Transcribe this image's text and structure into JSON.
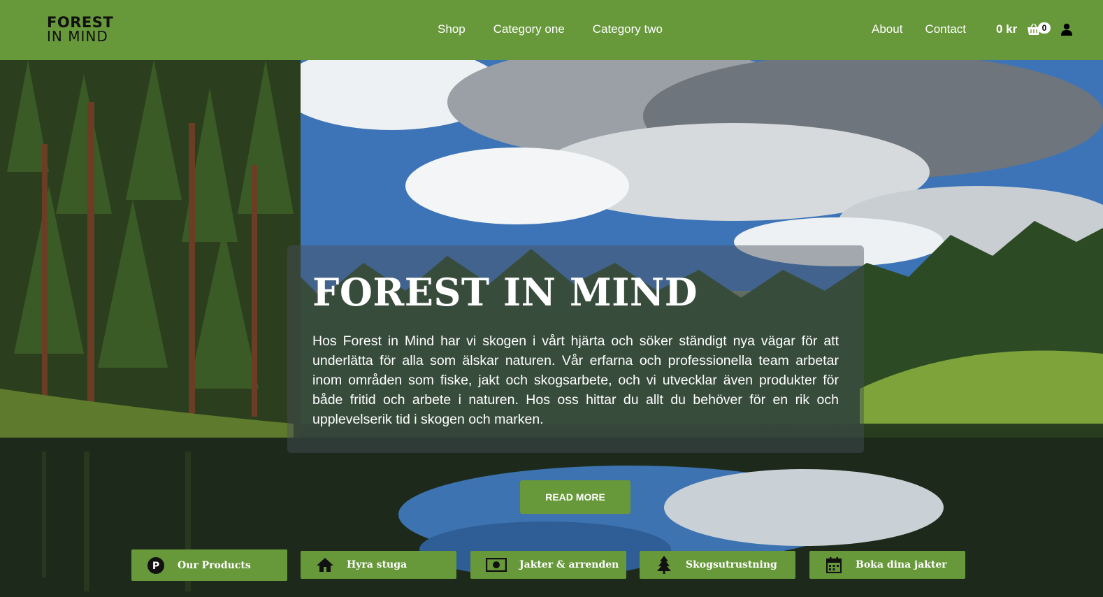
{
  "logo": {
    "line1": "FOREST",
    "line2": "IN MIND"
  },
  "nav": {
    "center": [
      "Shop",
      "Category one",
      "Category two"
    ],
    "right": [
      "About",
      "Contact"
    ]
  },
  "cart": {
    "total": "0 kr",
    "count": "0",
    "icon": "basket-icon"
  },
  "user": {
    "icon": "user-icon"
  },
  "hero": {
    "title": "FOREST IN MIND",
    "text": "Hos Forest in Mind har vi skogen i vårt hjärta och söker ständigt nya vägar för att underlätta för alla som älskar naturen. Vår erfarna och professionella team arbetar inom områden som fiske, jakt och skogsarbete, och vi utvecklar även produkter för både fritid och arbete i naturen. Hos oss hittar du allt du behöver för en rik och upplevelserik tid i skogen och marken.",
    "button": "READ MORE"
  },
  "categories": [
    {
      "label": "Our Products",
      "icon": "product-p-icon"
    },
    {
      "label": "Hyra stuga",
      "icon": "house-icon"
    },
    {
      "label": "Jakter & arrenden",
      "icon": "money-icon"
    },
    {
      "label": "Skogsutrustning",
      "icon": "tree-icon"
    },
    {
      "label": "Boka dina jakter",
      "icon": "calendar-icon"
    }
  ],
  "colors": {
    "brand": "#67983a",
    "text_light": "#ffffff",
    "logo": "#111111"
  }
}
